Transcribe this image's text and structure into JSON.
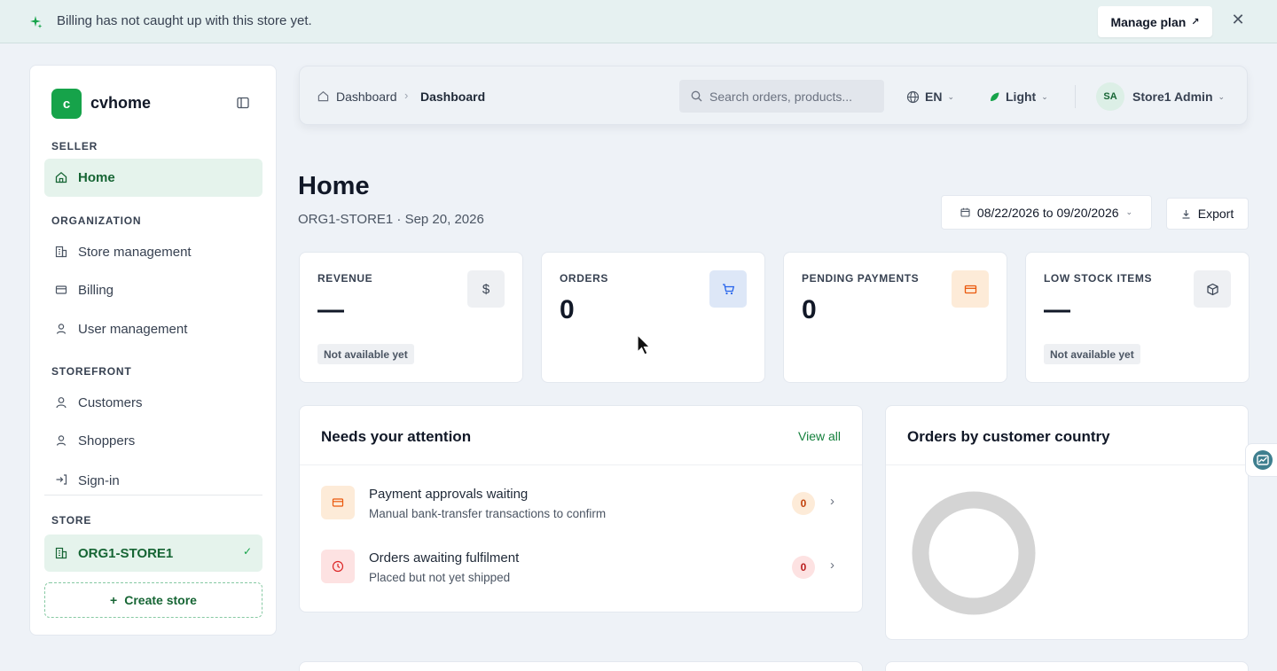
{
  "banner": {
    "message": "Billing has not caught up with this store yet.",
    "manage_plan_label": "Manage plan",
    "manage_plan_arrow": "↗",
    "close_glyph": "✕"
  },
  "sidebar": {
    "brand_letter": "c",
    "brand_name": "cvhome",
    "sections": {
      "seller": "SELLER",
      "organization": "ORGANIZATION",
      "storefront": "STOREFRONT",
      "store": "STORE"
    },
    "items": [
      {
        "label": "Home",
        "icon": "home-icon"
      },
      {
        "label": "Store management",
        "icon": "building-icon"
      },
      {
        "label": "Billing",
        "icon": "credit-card-icon"
      },
      {
        "label": "User management",
        "icon": "user-badge-icon"
      },
      {
        "label": "Customers",
        "icon": "user-icon"
      },
      {
        "label": "Shoppers",
        "icon": "user-badge-icon"
      },
      {
        "label": "Sign-in",
        "icon": "sign-in-icon"
      }
    ],
    "current_store": "ORG1-STORE1",
    "create_store_label": "Create store",
    "create_store_glyph": "+"
  },
  "topbar": {
    "breadcrumb": [
      "Dashboard",
      "Dashboard"
    ],
    "search_placeholder": "Search orders, products...",
    "language": "EN",
    "theme": "Light",
    "avatar_initials": "SA",
    "user_name": "Store1 Admin"
  },
  "header": {
    "title": "Home",
    "subtitle": "ORG1-STORE1 · Sep 20, 2026",
    "date_range": "08/22/2026 to 09/20/2026",
    "export_label": "Export"
  },
  "stats": [
    {
      "label": "REVENUE",
      "value": "—",
      "badge": "Not available yet",
      "icon": "dollar-icon",
      "icon_glyph": "$"
    },
    {
      "label": "ORDERS",
      "value": "0",
      "badge": "",
      "icon": "cart-icon"
    },
    {
      "label": "PENDING PAYMENTS",
      "value": "0",
      "badge": "",
      "icon": "credit-card-icon"
    },
    {
      "label": "LOW STOCK ITEMS",
      "value": "—",
      "badge": "Not available yet",
      "icon": "box-icon"
    }
  ],
  "attention": {
    "title": "Needs your attention",
    "view_all": "View all",
    "rows": [
      {
        "title": "Payment approvals waiting",
        "desc": "Manual bank-transfer transactions to confirm",
        "count": "0",
        "icon": "credit-card-icon"
      },
      {
        "title": "Orders awaiting fulfilment",
        "desc": "Placed but not yet shipped",
        "count": "0",
        "icon": "clock-icon"
      }
    ]
  },
  "country_panel": {
    "title": "Orders by customer country"
  },
  "colors": {
    "brand": "#16a34a",
    "active_bg": "#e5f3ec",
    "active_text": "#166534",
    "page_bg": "#eef2f7"
  }
}
